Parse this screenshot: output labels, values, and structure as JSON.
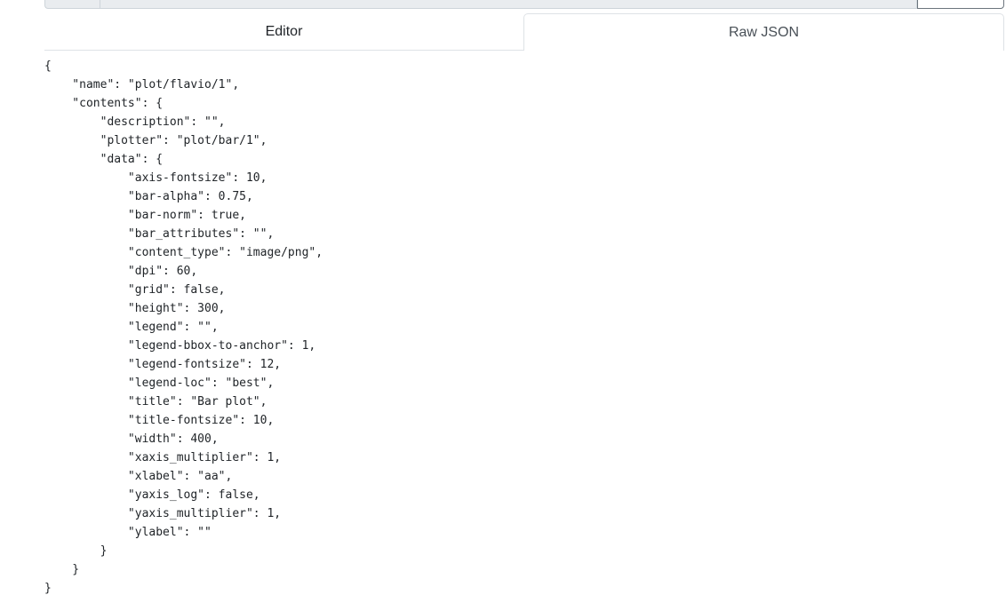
{
  "tabs": {
    "editor_label": "Editor",
    "raw_json_label": "Raw JSON"
  },
  "json_lines": [
    "{",
    "    \"name\": \"plot/flavio/1\",",
    "    \"contents\": {",
    "        \"description\": \"\",",
    "        \"plotter\": \"plot/bar/1\",",
    "        \"data\": {",
    "            \"axis-fontsize\": 10,",
    "            \"bar-alpha\": 0.75,",
    "            \"bar-norm\": true,",
    "            \"bar_attributes\": \"\",",
    "            \"content_type\": \"image/png\",",
    "            \"dpi\": 60,",
    "            \"grid\": false,",
    "            \"height\": 300,",
    "            \"legend\": \"\",",
    "            \"legend-bbox-to-anchor\": 1,",
    "            \"legend-fontsize\": 12,",
    "            \"legend-loc\": \"best\",",
    "            \"title\": \"Bar plot\",",
    "            \"title-fontsize\": 10,",
    "            \"width\": 400,",
    "            \"xaxis_multiplier\": 1,",
    "            \"xlabel\": \"aa\",",
    "            \"yaxis_log\": false,",
    "            \"yaxis_multiplier\": 1,",
    "            \"ylabel\": \"\"",
    "        }",
    "    }",
    "}"
  ]
}
